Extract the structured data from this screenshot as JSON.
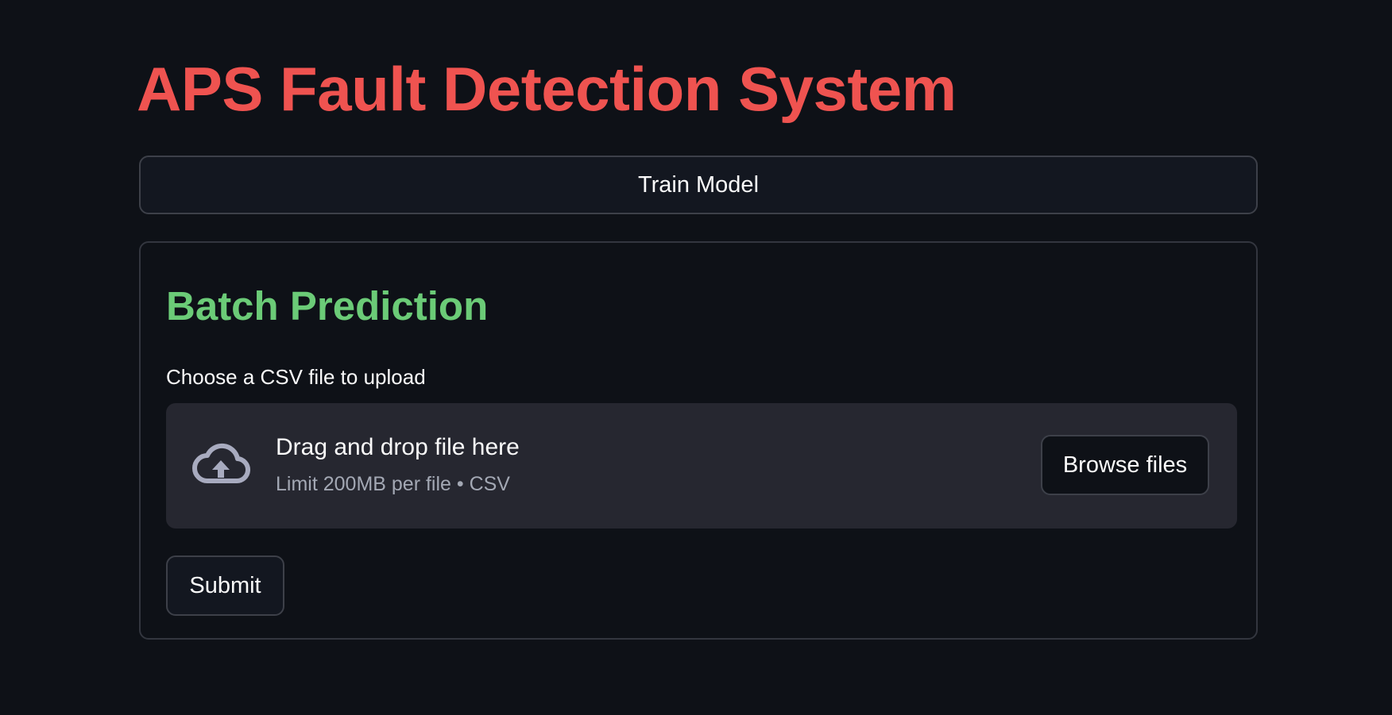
{
  "page": {
    "title": "APS Fault Detection System",
    "title_color": "#ef5350",
    "background": "#0e1117"
  },
  "train": {
    "button_label": "Train Model"
  },
  "batch": {
    "heading": "Batch Prediction",
    "heading_color": "#6bcb77",
    "upload_label": "Choose a CSV file to upload",
    "dropzone": {
      "icon": "cloud-upload-icon",
      "main_text": "Drag and drop file here",
      "sub_text": "Limit 200MB per file • CSV",
      "browse_label": "Browse files"
    },
    "submit_label": "Submit"
  }
}
